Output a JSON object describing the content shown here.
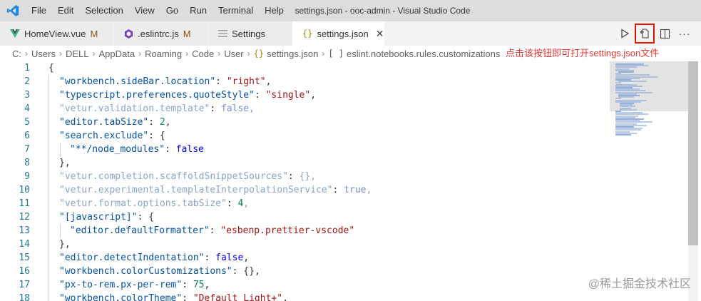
{
  "menu": [
    "File",
    "Edit",
    "Selection",
    "View",
    "Go",
    "Run",
    "Terminal",
    "Help"
  ],
  "window_title": "settings.json -       ooc-admin - Visual Studio Code",
  "tabs": [
    {
      "label": "HomeView.vue",
      "badge": "M",
      "icon": "vue-icon",
      "icon_color": "#41b883"
    },
    {
      "label": ".eslintrc.js",
      "badge": "M",
      "icon": "eslint-icon",
      "icon_color": "#7b3fb3"
    },
    {
      "label": "Settings",
      "badge": "",
      "icon": "settings-lines-icon",
      "icon_color": "#9a9a9a"
    },
    {
      "label": "settings.json",
      "badge": "",
      "icon": "json-braces-icon",
      "icon_color": "#b8860b",
      "active": true
    }
  ],
  "breadcrumb": [
    "C:",
    "Users",
    "DELL",
    "AppData",
    "Roaming",
    "Code",
    "User",
    "settings.json",
    "eslint.notebooks.rules.customizations"
  ],
  "annotation": "点击该按钮即可打开settings.json文件",
  "watermark": "@稀土掘金技术社区",
  "colors": {
    "annotation": "#e53935",
    "highlight_box": "#e51400",
    "modified": "#895503"
  },
  "code_lines": [
    {
      "num": "1",
      "text": "{"
    },
    {
      "num": "2",
      "key": "\"workbench.sideBar.location\"",
      "value": "\"right\"",
      "vtype": "s",
      "end": ","
    },
    {
      "num": "3",
      "key": "\"typescript.preferences.quoteStyle\"",
      "value": "\"single\"",
      "vtype": "s",
      "end": ","
    },
    {
      "num": "4",
      "key": "\"vetur.validation.template\"",
      "value": "false",
      "vtype": "b",
      "end": ",",
      "dim": true
    },
    {
      "num": "5",
      "key": "\"editor.tabSize\"",
      "value": "2",
      "vtype": "n",
      "end": ","
    },
    {
      "num": "6",
      "key": "\"search.exclude\"",
      "value": "{",
      "vtype": "p",
      "end": ""
    },
    {
      "num": "7",
      "key": "\"**/node_modules\"",
      "value": "false",
      "vtype": "b",
      "end": "",
      "indent": 2
    },
    {
      "num": "8",
      "text": "},",
      "indent": 1
    },
    {
      "num": "9",
      "key": "\"vetur.completion.scaffoldSnippetSources\"",
      "value": "{}",
      "vtype": "p",
      "end": ",",
      "dim": true
    },
    {
      "num": "10",
      "key": "\"vetur.experimental.templateInterpolationService\"",
      "value": "true",
      "vtype": "b",
      "end": ",",
      "dim": true
    },
    {
      "num": "11",
      "key": "\"vetur.format.options.tabSize\"",
      "value": "4",
      "vtype": "n",
      "end": ",",
      "dim": true
    },
    {
      "num": "12",
      "key": "\"[javascript]\"",
      "value": "{",
      "vtype": "p",
      "end": ""
    },
    {
      "num": "13",
      "key": "\"editor.defaultFormatter\"",
      "value": "\"esbenp.prettier-vscode\"",
      "vtype": "s",
      "end": "",
      "indent": 2
    },
    {
      "num": "14",
      "text": "},",
      "indent": 1
    },
    {
      "num": "15",
      "key": "\"editor.detectIndentation\"",
      "value": "false",
      "vtype": "b",
      "end": ","
    },
    {
      "num": "16",
      "key": "\"workbench.colorCustomizations\"",
      "value": "{}",
      "vtype": "p",
      "end": ","
    },
    {
      "num": "17",
      "key": "\"px-to-rem.px-per-rem\"",
      "value": "75",
      "vtype": "n",
      "end": ","
    },
    {
      "num": "18",
      "key": "\"workbench.colorTheme\"",
      "value": "\"Default Light+\"",
      "vtype": "s",
      "end": ","
    }
  ]
}
